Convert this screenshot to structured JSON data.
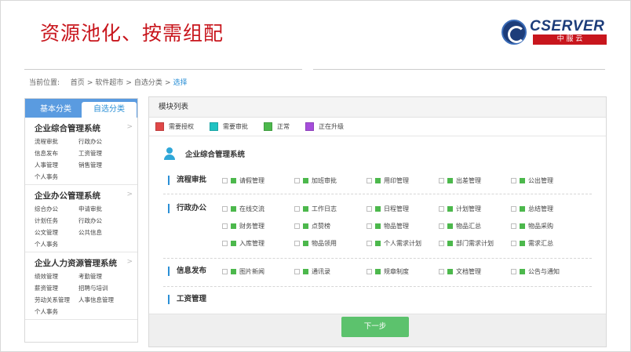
{
  "slide": {
    "title": "资源池化、按需组配",
    "logo": {
      "name": "CSERVER",
      "subtitle": "中 服 云"
    }
  },
  "breadcrumb": {
    "prefix": "当前位置:",
    "items": [
      "首页",
      "软件超市",
      "自选分类",
      "选择"
    ],
    "separator": ">"
  },
  "sidebar": {
    "tabs": [
      "基本分类",
      "自选分类"
    ],
    "active_tab": "自选分类",
    "groups": [
      {
        "title": "企业综合管理系统",
        "items": [
          "流程审批",
          "行政办公",
          "信息发布",
          "工资管理",
          "人事管理",
          "销售管理",
          "个人事务"
        ]
      },
      {
        "title": "企业办公管理系统",
        "items": [
          "综合办公",
          "申请审批",
          "计划任务",
          "行政办公",
          "公文管理",
          "公共信息",
          "个人事务"
        ]
      },
      {
        "title": "企业人力资源管理系统",
        "items": [
          "绩效管理",
          "考勤管理",
          "薪资管理",
          "招聘与培训",
          "劳动关系管理",
          "人事信息管理",
          "个人事务"
        ]
      }
    ],
    "chevron": ">"
  },
  "panel": {
    "header": "模块列表",
    "legend": [
      {
        "label": "需要授权",
        "color": "#e04848"
      },
      {
        "label": "需要审批",
        "color": "#1fc2c2"
      },
      {
        "label": "正常",
        "color": "#4cb84c"
      },
      {
        "label": "正在升级",
        "color": "#a64ddb"
      }
    ],
    "system_title": "企业综合管理系统",
    "categories": [
      {
        "label": "流程审批",
        "modules": [
          "请假管理",
          "加班审批",
          "用印管理",
          "出差管理",
          "公出管理"
        ]
      },
      {
        "label": "行政办公",
        "modules": [
          "在线交流",
          "工作日志",
          "日程管理",
          "计划管理",
          "总结管理",
          "财务管理",
          "点赞榜",
          "物品管理",
          "物品汇总",
          "物品采购",
          "入库管理",
          "物品领用",
          "个人需求计划",
          "部门需求计划",
          "需求汇总"
        ]
      },
      {
        "label": "信息发布",
        "modules": [
          "图片新闻",
          "通讯录",
          "规章制度",
          "文档管理",
          "公告与通知"
        ]
      },
      {
        "label": "工资管理",
        "modules": []
      }
    ],
    "module_status_color": "#4cb84c",
    "next_button": "下一步"
  }
}
